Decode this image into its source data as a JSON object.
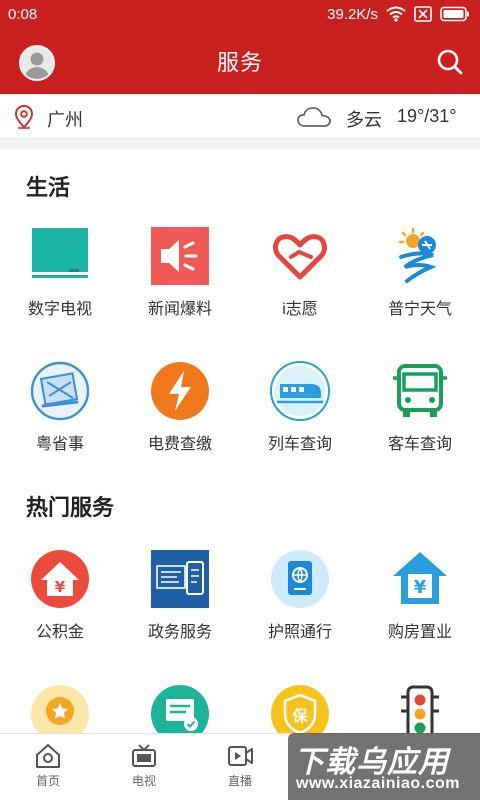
{
  "status_bar": {
    "time": "0:08",
    "speed": "39.2K/s",
    "icons": [
      "wifi-icon",
      "sim-off-icon",
      "battery-icon"
    ]
  },
  "header": {
    "title": "服务",
    "avatar": "avatar",
    "search": "search-icon"
  },
  "location": {
    "city": "广州",
    "weather": "多云",
    "temperature": "19°/31°",
    "icons": [
      "location-pin-icon",
      "cloud-icon"
    ]
  },
  "sections": [
    {
      "title": "生活",
      "items": [
        {
          "label": "数字电视",
          "icon": "tv-icon"
        },
        {
          "label": "新闻爆料",
          "icon": "speaker-icon"
        },
        {
          "label": "i志愿",
          "icon": "heart-hand-icon"
        },
        {
          "label": "普宁天气",
          "icon": "weather-logo-icon"
        },
        {
          "label": "粤省事",
          "icon": "yue-logo-icon"
        },
        {
          "label": "电费查缴",
          "icon": "lightning-icon"
        },
        {
          "label": "列车查询",
          "icon": "train-icon"
        },
        {
          "label": "客车查询",
          "icon": "bus-icon"
        }
      ]
    },
    {
      "title": "热门服务",
      "items": [
        {
          "label": "公积金",
          "icon": "house-yen-icon"
        },
        {
          "label": "政务服务",
          "icon": "gov-service-icon"
        },
        {
          "label": "护照通行",
          "icon": "passport-icon"
        },
        {
          "label": "购房置业",
          "icon": "house-purchase-icon"
        },
        {
          "label": "",
          "icon": "award-icon"
        },
        {
          "label": "",
          "icon": "printer-icon"
        },
        {
          "label": "",
          "icon": "insurance-icon"
        },
        {
          "label": "",
          "icon": "traffic-light-icon"
        }
      ]
    }
  ],
  "bottom_nav": [
    {
      "label": "首页",
      "icon": "home-icon"
    },
    {
      "label": "电视",
      "icon": "tv-nav-icon"
    },
    {
      "label": "直播",
      "icon": "live-icon"
    }
  ],
  "watermark": {
    "title": "下载乌应用",
    "url": "www.xiazainiao.com"
  },
  "colors": {
    "brand_red": "#c8211f",
    "teal": "#1bb3a6",
    "orange": "#f07a1b",
    "blue": "#1aa0e0"
  }
}
